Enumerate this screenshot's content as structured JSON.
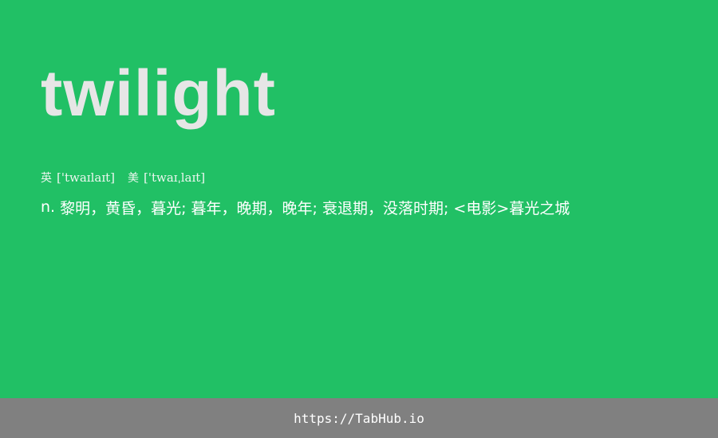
{
  "entry": {
    "word": "twilight",
    "phonetics": {
      "uk_label": "英",
      "uk_ipa": "['twaɪlaɪt]",
      "us_label": "美",
      "us_ipa": "['twaɪˌlaɪt]"
    },
    "definition": {
      "part_of_speech": "n.",
      "meaning": "黎明，黄昏，暮光; 暮年，晚期，晚年; 衰退期，没落时期; <电影>暮光之城"
    }
  },
  "footer": {
    "link_text": "https://TabHub.io"
  },
  "colors": {
    "background": "#21c065",
    "word": "#e6e6e6",
    "footer_background": "#808080",
    "footer_text": "#ffffff"
  }
}
